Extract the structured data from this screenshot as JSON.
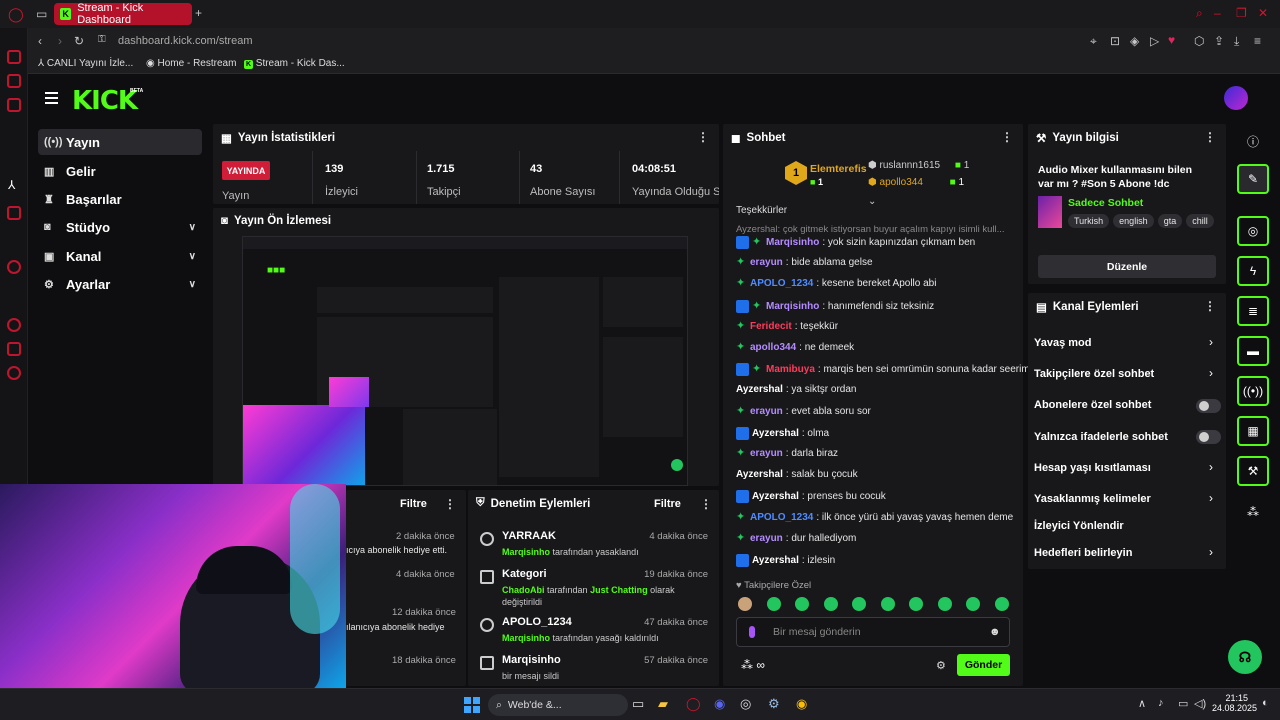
{
  "browser": {
    "tab_title": "Stream - Kick Dashboard",
    "new_tab": "+",
    "url": "dashboard.kick.com/stream",
    "bookmarks": [
      "CANLI Yayını İzle...",
      "Home - Restream",
      "Stream - Kick Das..."
    ]
  },
  "kick": {
    "logo": "KICK",
    "beta": "BETA",
    "nav": [
      {
        "label": "Yayın",
        "icon": "broadcast-icon"
      },
      {
        "label": "Gelir",
        "icon": "chart-icon"
      },
      {
        "label": "Başarılar",
        "icon": "trophy-icon"
      },
      {
        "label": "Stüdyo",
        "icon": "camera-icon"
      },
      {
        "label": "Kanal",
        "icon": "tv-icon"
      },
      {
        "label": "Ayarlar",
        "icon": "gear-icon"
      }
    ]
  },
  "stats": {
    "title": "Yayın İstatistikleri",
    "live": "YAYINDA",
    "live_label": "Yayın",
    "viewers": "139",
    "viewers_label": "İzleyici",
    "followers": "1.715",
    "followers_label": "Takipçi",
    "subs": "43",
    "subs_label": "Abone Sayısı",
    "uptime": "04:08:51",
    "uptime_label": "Yayında Olduğu Süre"
  },
  "preview": {
    "title": "Yayın Ön İzlemesi"
  },
  "activity": {
    "filter": "Filtre",
    "items": [
      {
        "time": "2 dakika önce",
        "text": "ıcıya abonelik hediye etti."
      },
      {
        "time": "4 dakika önce",
        "text": ""
      },
      {
        "time": "12 dakika önce",
        "text": "ılanıcıya abonelik hediye"
      },
      {
        "time": "18 dakika önce",
        "text": ""
      }
    ]
  },
  "moderation": {
    "title": "Denetim Eylemleri",
    "filter": "Filtre",
    "items": [
      {
        "title": "YARRAAK",
        "actor": "Marqisinho",
        "desc": "tarafından yasaklandı",
        "time": "4 dakika önce"
      },
      {
        "title": "Kategori",
        "actor": "ChadoAbi",
        "desc": "tarafından",
        "extra": "Just Chatting",
        "desc2": "olarak değiştirildi",
        "time": "19 dakika önce"
      },
      {
        "title": "APOLO_1234",
        "actor": "Marqisinho",
        "desc": "tarafından yasağı kaldırıldı",
        "time": "47 dakika önce"
      },
      {
        "title": "Marqisinho",
        "actor": "",
        "desc": "bir mesajı sildi",
        "time": "57 dakika önce"
      }
    ]
  },
  "chat": {
    "title": "Sohbet",
    "leaders": [
      {
        "rank": "1",
        "name": "Elemterefis",
        "count": "1"
      },
      {
        "name": "ruslannn1615",
        "count": "1"
      },
      {
        "name": "apollo344",
        "count": "1"
      }
    ],
    "pinned": "Teşekkürler",
    "faded": "Ayzershal: çok gitmek istiyorsan buyur açalım kapıyı isimli kull...",
    "messages": [
      {
        "user": "Marqisinho",
        "text": ": yok sizin kapınızdan çıkmam ben",
        "color": "#b48cff"
      },
      {
        "user": "erayun",
        "text": ": bide ablama gelse",
        "color": "#b48cff"
      },
      {
        "user": "APOLO_1234",
        "text": ": kesene bereket Apollo abi",
        "color": "#4f8cff"
      },
      {
        "user": "Marqisinho",
        "text": ": hanımefendi siz teksiniz",
        "color": "#b48cff"
      },
      {
        "user": "Feridecit",
        "text": ": teşekkür",
        "color": "#ff3b5c"
      },
      {
        "user": "apollo344",
        "text": ": ne demeek",
        "color": "#b48cff"
      },
      {
        "user": "Mamibuya",
        "text": ": marqis ben sei omrümün sonuna kadar seerim",
        "color": "#ff3b5c"
      },
      {
        "user": "Ayzershal",
        "text": ": ya siktşr ordan",
        "color": "#ffffff"
      },
      {
        "user": "erayun",
        "text": ": evet abla soru sor",
        "color": "#b48cff"
      },
      {
        "user": "Ayzershal",
        "text": ": olma",
        "color": "#ffffff"
      },
      {
        "user": "erayun",
        "text": ": darla biraz",
        "color": "#b48cff"
      },
      {
        "user": "Ayzershal",
        "text": ": salak bu çocuk",
        "color": "#ffffff"
      },
      {
        "user": "Ayzershal",
        "text": ": prenses bu cocuk",
        "color": "#ffffff"
      },
      {
        "user": "APOLO_1234",
        "text": ": ilk önce yürü abi yavaş yavaş hemen deme",
        "color": "#4f8cff"
      },
      {
        "user": "erayun",
        "text": ": dur hallediyom",
        "color": "#b48cff"
      },
      {
        "user": "Ayzershal",
        "text": ": izlesin",
        "color": "#ffffff"
      }
    ],
    "followers_only": "Takipçilere Özel",
    "input_placeholder": "Bir mesaj gönderin",
    "send": "Gönder"
  },
  "info": {
    "title": "Yayın bilgisi",
    "stream_title": "Audio Mixer kullanmasını bilen var mı ? #Son 5 Abone !dc",
    "category": "Sadece Sohbet",
    "tags": [
      "Turkish",
      "english",
      "gta",
      "chill"
    ],
    "edit": "Düzenle"
  },
  "channel_actions": {
    "title": "Kanal Eylemleri",
    "items": [
      {
        "label": "Yavaş mod",
        "kind": "chevron"
      },
      {
        "label": "Takipçilere özel sohbet",
        "kind": "chevron"
      },
      {
        "label": "Abonelere özel sohbet",
        "kind": "toggle"
      },
      {
        "label": "Yalnızca ifadelerle sohbet",
        "kind": "toggle"
      },
      {
        "label": "Hesap yaşı kısıtlaması",
        "kind": "chevron"
      },
      {
        "label": "Yasaklanmış kelimeler",
        "kind": "chevron"
      },
      {
        "label": "İzleyici Yönlendir",
        "kind": "none"
      },
      {
        "label": "Hedefleri belirleyin",
        "kind": "chevron"
      }
    ]
  },
  "taskbar": {
    "search": "Web'de &...",
    "time": "21:15",
    "date": "24.08.2025"
  }
}
